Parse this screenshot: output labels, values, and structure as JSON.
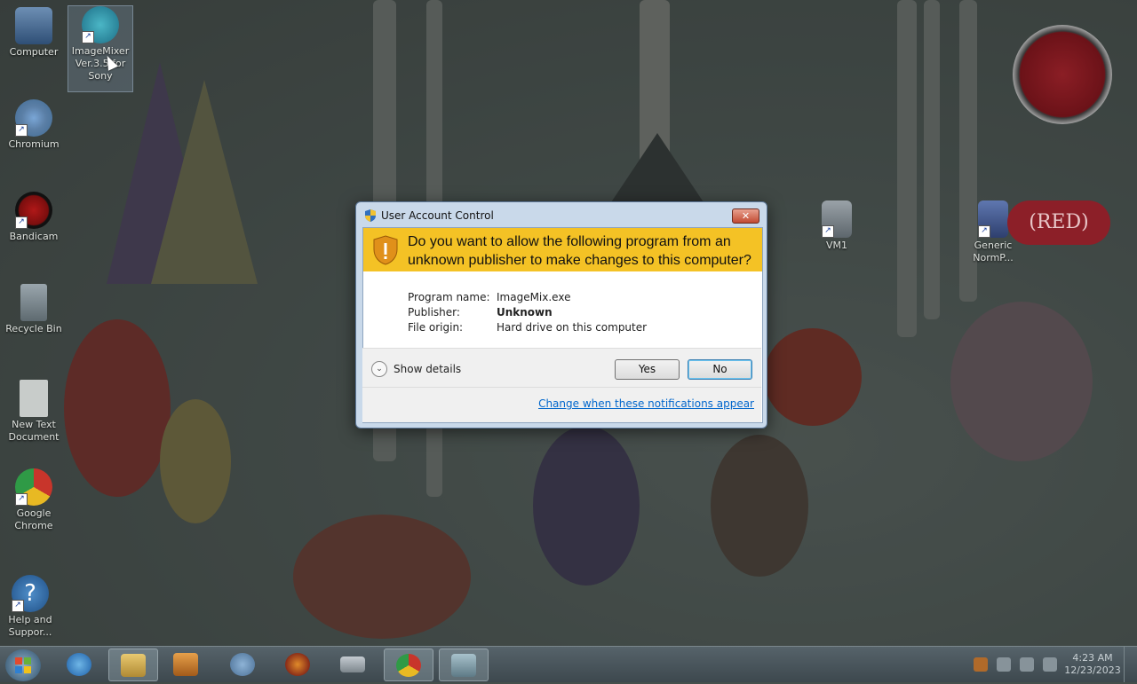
{
  "desktop": {
    "icons": [
      {
        "label": "Computer"
      },
      {
        "label": "ImageMixer Ver.3.5 for Sony"
      },
      {
        "label": "Chromium"
      },
      {
        "label": "Bandicam"
      },
      {
        "label": "Recycle Bin"
      },
      {
        "label": "New Text Document"
      },
      {
        "label": "Google Chrome"
      },
      {
        "label": "Help and Suppor..."
      },
      {
        "label": "VM1"
      },
      {
        "label": "Generic NormP..."
      }
    ],
    "red_badge": "(RED)"
  },
  "dialog": {
    "title": "User Account Control",
    "close_label": "✕",
    "question": "Do you want to allow the following program from an unknown publisher to make changes to this computer?",
    "fields": [
      {
        "key": "Program name:",
        "value": "ImageMix.exe",
        "bold": false
      },
      {
        "key": "Publisher:",
        "value": "Unknown",
        "bold": true
      },
      {
        "key": "File origin:",
        "value": "Hard drive on this computer",
        "bold": false
      }
    ],
    "show_details": "Show details",
    "yes_label": "Yes",
    "no_label": "No",
    "change_link": "Change when these notifications appear",
    "colors": {
      "banner": "#f4c225",
      "link": "#0066cc"
    }
  },
  "taskbar": {
    "items": [
      {
        "name": "internet-explorer-icon",
        "active": false
      },
      {
        "name": "file-explorer-icon",
        "active": true
      },
      {
        "name": "media-player-icon",
        "active": false
      },
      {
        "name": "chromium-icon",
        "active": false
      },
      {
        "name": "firefox-icon",
        "active": false
      },
      {
        "name": "keyboard-icon",
        "active": false
      },
      {
        "name": "chrome-icon",
        "active": true
      },
      {
        "name": "window-icon",
        "active": true
      }
    ],
    "time": "4:23 AM",
    "date": "12/23/2023"
  }
}
